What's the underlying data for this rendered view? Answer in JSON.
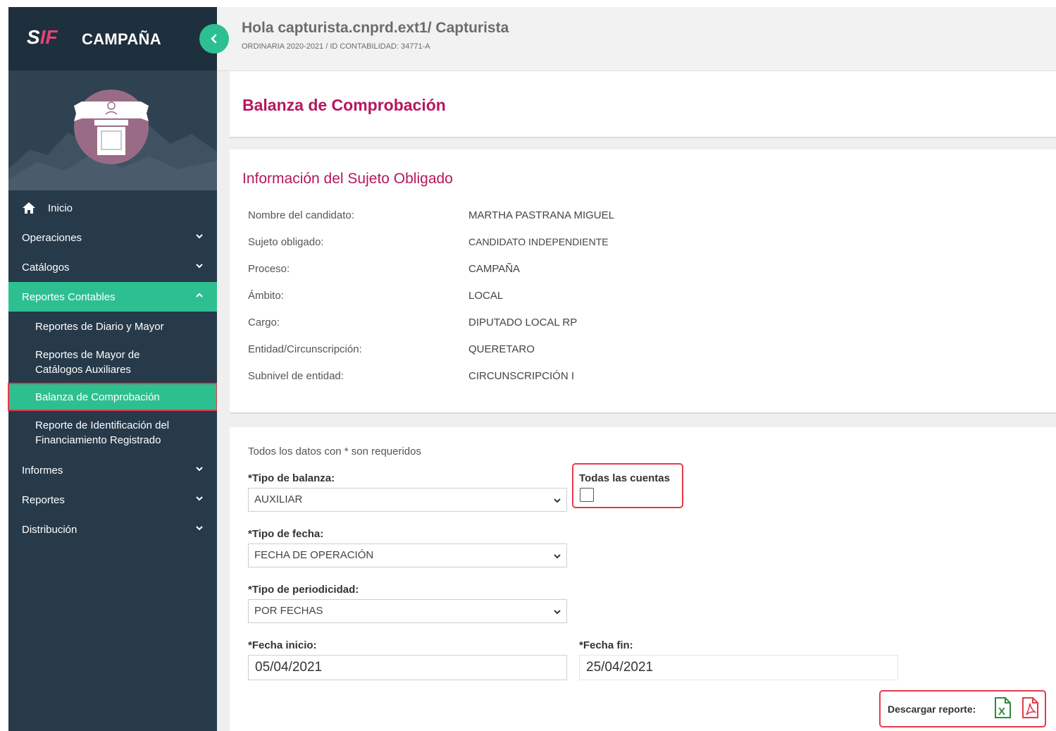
{
  "app": {
    "logo_s": "S",
    "logo_if": "IF",
    "title": "CAMPAÑA"
  },
  "sidebar": {
    "items": [
      {
        "label": "Inicio"
      },
      {
        "label": "Operaciones"
      },
      {
        "label": "Catálogos"
      },
      {
        "label": "Reportes Contables"
      },
      {
        "label": "Informes"
      },
      {
        "label": "Reportes"
      },
      {
        "label": "Distribución"
      }
    ],
    "sub_items": [
      {
        "label": "Reportes de Diario y Mayor"
      },
      {
        "label": "Reportes de Mayor de Catálogos Auxiliares"
      },
      {
        "label": "Balanza de Comprobación"
      },
      {
        "label": "Reporte de Identificación del Financiamiento Registrado"
      }
    ]
  },
  "header": {
    "greeting": "Hola capturista.cnprd.ext1/ Capturista",
    "subinfo": "ORDINARIA 2020-2021 / ID CONTABILIDAD: 34771-A"
  },
  "page": {
    "title": "Balanza de Comprobación"
  },
  "info": {
    "title": "Información del Sujeto Obligado",
    "rows": [
      {
        "label": "Nombre del candidato:",
        "value": "MARTHA PASTRANA MIGUEL"
      },
      {
        "label": "Sujeto obligado:",
        "value": "CANDIDATO INDEPENDIENTE"
      },
      {
        "label": "Proceso:",
        "value": "CAMPAÑA"
      },
      {
        "label": "Ámbito:",
        "value": "LOCAL"
      },
      {
        "label": "Cargo:",
        "value": "DIPUTADO LOCAL RP"
      },
      {
        "label": "Entidad/Circunscripción:",
        "value": "QUERETARO"
      },
      {
        "label": "Subnivel de entidad:",
        "value": "CIRCUNSCRIPCIÓN I"
      }
    ]
  },
  "form": {
    "required_note": "Todos los datos con * son requeridos",
    "tipo_balanza": {
      "label": "*Tipo de balanza:",
      "value": "AUXILIAR"
    },
    "todas_cuentas": {
      "label": "Todas las cuentas",
      "checked": false
    },
    "tipo_fecha": {
      "label": "*Tipo de fecha:",
      "value": "FECHA DE OPERACIÓN"
    },
    "tipo_periodicidad": {
      "label": "*Tipo de periodicidad:",
      "value": "POR FECHAS"
    },
    "fecha_inicio": {
      "label": "*Fecha inicio:",
      "value": "05/04/2021"
    },
    "fecha_fin": {
      "label": "*Fecha fin:",
      "value": "25/04/2021"
    },
    "download": {
      "label": "Descargar reporte:",
      "excel_glyph": "X"
    }
  },
  "colors": {
    "sidebar_bg": "#263a4a",
    "accent_green": "#2ebf91",
    "title_magenta": "#b5175e",
    "highlight_red": "#e53a4a"
  }
}
